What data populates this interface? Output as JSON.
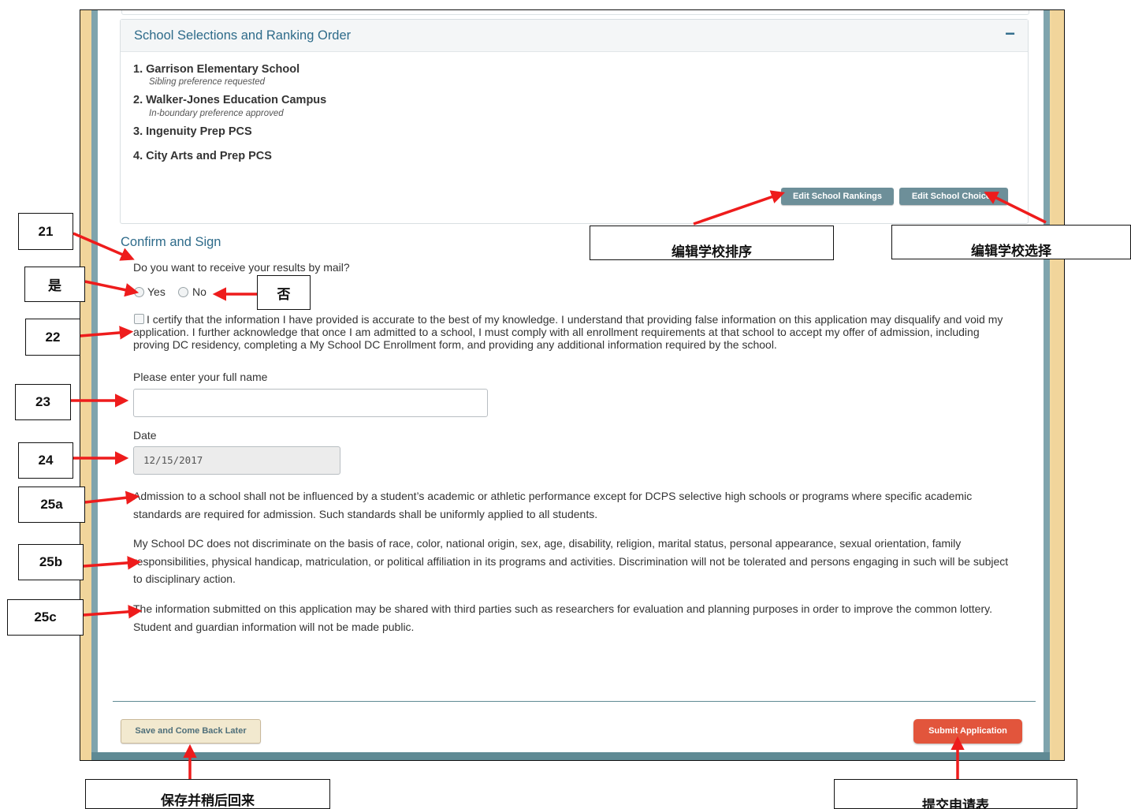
{
  "panel": {
    "title": "School Selections and Ranking Order",
    "collapse_symbol": "−",
    "schools": [
      {
        "name": "1. Garrison Elementary School",
        "note": "Sibling preference requested"
      },
      {
        "name": "2. Walker-Jones Education Campus",
        "note": "In-boundary preference approved"
      },
      {
        "name": "3. Ingenuity Prep PCS",
        "note": ""
      },
      {
        "name": "4. City Arts and Prep PCS",
        "note": ""
      }
    ],
    "edit_rankings_label": "Edit School Rankings",
    "edit_choices_label": "Edit School Choices"
  },
  "form": {
    "section_title": "Confirm and Sign",
    "mail_question": "Do you want to receive your results by mail?",
    "yes_label": "Yes",
    "no_label": "No",
    "certify_text": "I certify that the information I have provided is accurate to the best of my knowledge. I understand that providing false information on this application may disqualify and void my application. I further acknowledge that once I am admitted to a school, I must comply with all enrollment requirements at that school to accept my offer of admission, including proving DC residency, completing a My School DC Enrollment form, and providing any additional information required by the school.",
    "name_label": "Please enter your full name",
    "name_value": "",
    "date_label": "Date",
    "date_value": "12/15/2017",
    "para_25a": "Admission to a school shall not be influenced by a student’s academic or athletic performance except for DCPS selective high schools or programs where specific academic standards are required for admission. Such standards shall be uniformly applied to all students.",
    "para_25b": "My School DC does not discriminate on the basis of race, color, national origin, sex, age, disability, religion, marital status, personal appearance, sexual orientation, family responsibilities, physical handicap, matriculation, or political affiliation in its programs and activities. Discrimination will not be tolerated and persons engaging in such will be subject to disciplinary action.",
    "para_25c": "The information submitted on this application may be shared with third parties such as researchers for evaluation and planning purposes in order to improve the common lottery. Student and guardian information will not be made public.",
    "save_label": "Save and Come Back Later",
    "submit_label": "Submit Application"
  },
  "annotations": {
    "n21": "21",
    "yes_cn": "是",
    "no_cn": "否",
    "n22": "22",
    "n23": "23",
    "n24": "24",
    "n25a": "25a",
    "n25b": "25b",
    "n25c": "25c",
    "edit_rankings_cn": "编辑学校排序",
    "edit_choices_cn": "编辑学校选择",
    "save_cn": "保存并稍后回来",
    "submit_cn": "提交申请表"
  },
  "colors": {
    "accent": "#2e6b8a",
    "arrow": "#ee1c1c",
    "submit": "#e2553c",
    "frame_tan": "#f1d59b"
  }
}
